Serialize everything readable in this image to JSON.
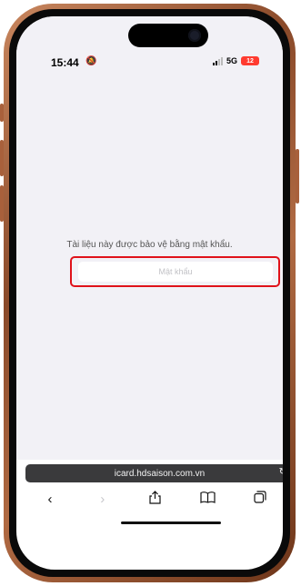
{
  "status_bar": {
    "time": "15:44",
    "silent_icon": "bell-slash-icon",
    "network": "5G",
    "battery": "12"
  },
  "page": {
    "message": "Tài liệu này được bảo vệ bằng mật khẩu.",
    "password_placeholder": "Mật khẩu",
    "password_value": ""
  },
  "browser": {
    "url": "icard.hdsaison.com.vn",
    "toolbar_icons": [
      "back-icon",
      "forward-icon",
      "share-icon",
      "bookmarks-icon",
      "tabs-icon"
    ]
  },
  "colors": {
    "highlight": "#e0121a",
    "page_background": "#f2f1f6",
    "battery_low": "#ff3b30",
    "frame": "#9b5a36"
  }
}
